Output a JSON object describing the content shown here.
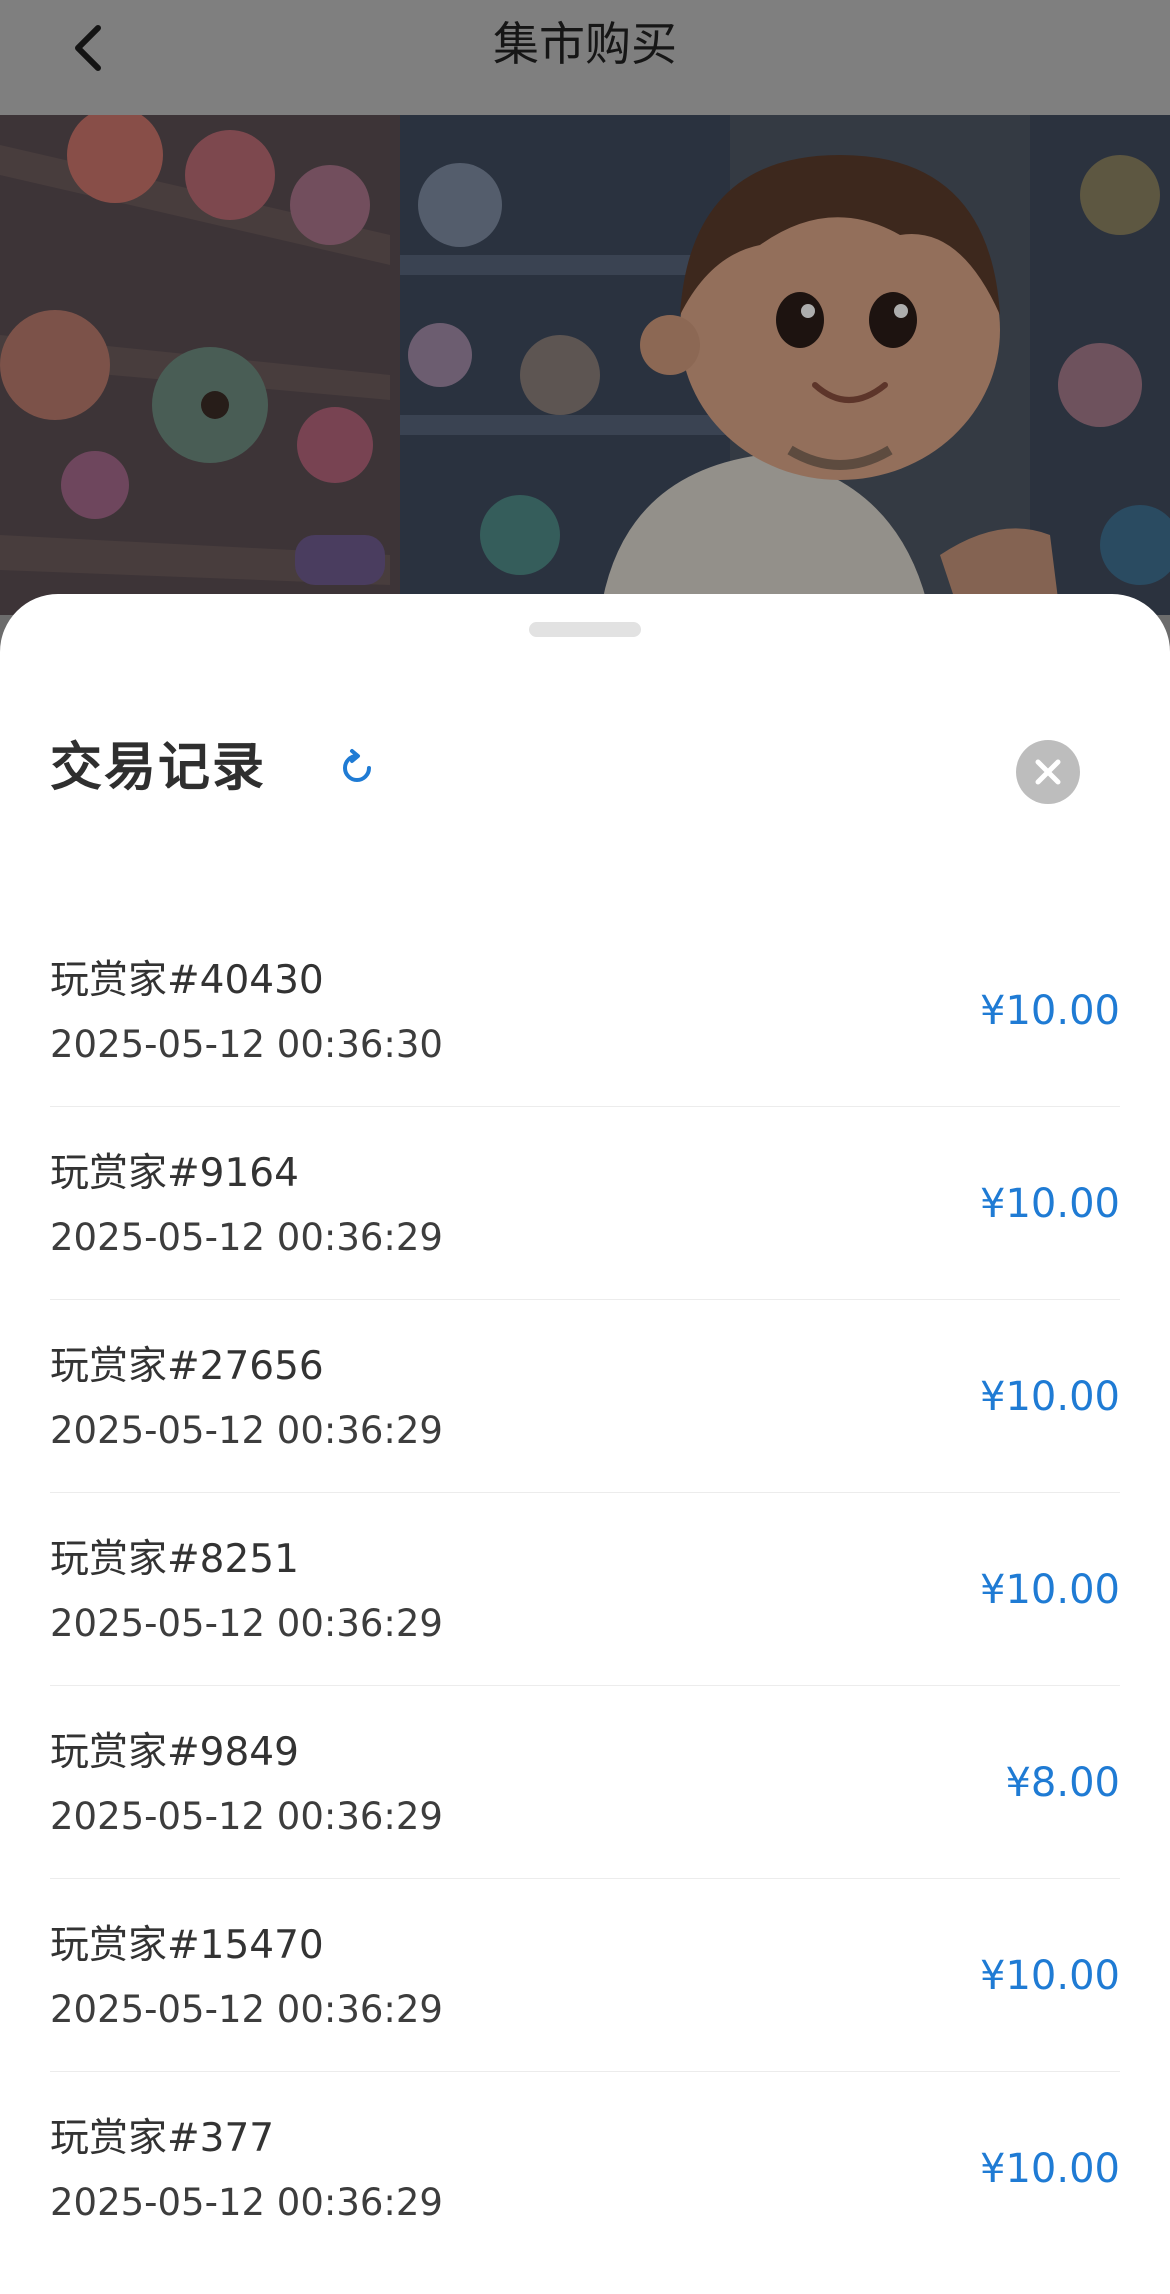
{
  "navbar": {
    "title": "集市购买",
    "back_icon": "chevron-left-icon"
  },
  "sheet": {
    "title": "交易记录",
    "refresh_icon": "refresh-icon",
    "close_icon": "close-icon"
  },
  "records": [
    {
      "name": "玩赏家#40430",
      "time": "2025-05-12 00:36:30",
      "price": "¥10.00"
    },
    {
      "name": "玩赏家#9164",
      "time": "2025-05-12 00:36:29",
      "price": "¥10.00"
    },
    {
      "name": "玩赏家#27656",
      "time": "2025-05-12 00:36:29",
      "price": "¥10.00"
    },
    {
      "name": "玩赏家#8251",
      "time": "2025-05-12 00:36:29",
      "price": "¥10.00"
    },
    {
      "name": "玩赏家#9849",
      "time": "2025-05-12 00:36:29",
      "price": "¥8.00"
    },
    {
      "name": "玩赏家#15470",
      "time": "2025-05-12 00:36:29",
      "price": "¥10.00"
    },
    {
      "name": "玩赏家#377",
      "time": "2025-05-12 00:36:29",
      "price": "¥10.00"
    }
  ],
  "colors": {
    "accent": "#1f7bd4",
    "overlay": "#7f7f7f",
    "close_bg": "#bdbdbd"
  }
}
